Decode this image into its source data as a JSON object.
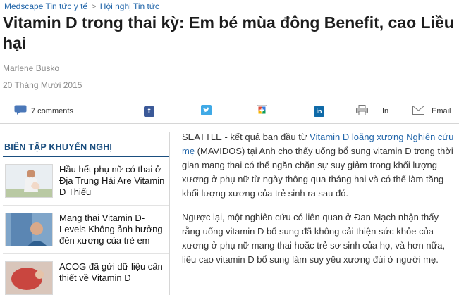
{
  "breadcrumb": {
    "part1": "Medscape Tin tức y tế",
    "separator": ">",
    "part2": "Hội nghị Tin tức"
  },
  "article": {
    "title": "Vitamin D trong thai kỳ: Em bé mùa đông Benefit, cao Liều hại",
    "author": "Marlene Busko",
    "date": "20 Tháng Mười 2015",
    "p1_lead": "SEATTLE - kết quả ban đầu từ ",
    "p1_link": "Vitamin D loãng xương Nghiên cứu mẹ",
    "p1_rest": " (MAVIDOS) tại Anh cho thấy uống bổ sung vitamin D trong thời gian mang thai có thể ngăn chặn sự suy giảm trong khối lượng xương ở phụ nữ từ ngày thông qua tháng hai và có thể làm tăng khối lượng xương của trẻ sinh ra sau đó.",
    "p2": "Ngược lại, một nghiên cứu có liên quan ở Đan Mạch nhận thấy rằng uống vitamin D bổ sung đã không cải thiện sức khỏe của xương ở phụ nữ mang thai hoặc trẻ sơ sinh của họ, và hơn nữa, liều cao vitamin D bổ sung làm suy yếu xương đùi ở người mẹ."
  },
  "toolbar": {
    "comments": "7 comments",
    "facebook": "f",
    "linkedin": "in",
    "print_label": "In",
    "email_label": "Email",
    "icons": [
      "comment-icon",
      "facebook-icon",
      "twitter-icon",
      "google-plus-icon",
      "linkedin-icon",
      "print-icon",
      "email-icon"
    ],
    "colors": {
      "facebook": "#3b5998",
      "twitter": "#3fa9e6",
      "google_plus": "#7fb33b",
      "linkedin": "#0f6aa8"
    }
  },
  "sidebar": {
    "heading": "BIÊN TẬP KHUYẾN NGHỊ",
    "items": [
      {
        "text": "Hầu hết phụ nữ có thai ở Địa Trung Hải Are Vitamin D Thiếu"
      },
      {
        "text": "Mang thai Vitamin D-Levels Không ảnh hưởng đến xương của trẻ em"
      },
      {
        "text": "ACOG đã gửi dữ liệu cần thiết về Vitamin D"
      }
    ]
  },
  "colors": {
    "link": "#2266aa",
    "sidebar_heading": "#1a4e7f",
    "meta_gray": "#8a8a8a"
  }
}
